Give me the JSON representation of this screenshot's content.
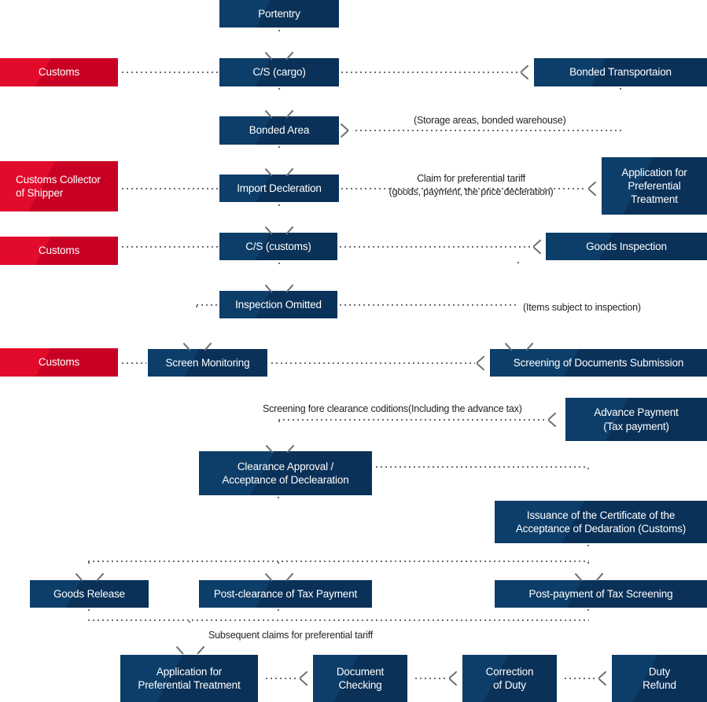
{
  "diagram": {
    "title": "Import Customs Clearance Procedure Flowchart",
    "colors": {
      "navy": "#0b3a63",
      "red": "#d90429",
      "connector": "#6d6e71",
      "label_text": "#231f20",
      "background": "#ffffff"
    }
  },
  "actors": [
    {
      "id": "actor-customs-1",
      "label": "Customs"
    },
    {
      "id": "actor-customs-collector",
      "label": "Customs Collector\nof Shipper",
      "line1": "Customs Collector",
      "line2": "of Shipper"
    },
    {
      "id": "actor-customs-2",
      "label": "Customs"
    },
    {
      "id": "actor-customs-3",
      "label": "Customs"
    }
  ],
  "nodes": {
    "portentry": "Portentry",
    "cs_cargo": "C/S (cargo)",
    "bonded_transportation": "Bonded Transportaion",
    "bonded_area": "Bonded Area",
    "import_declaration": "Import Decleration",
    "application_preferential_1_line1": "Application for",
    "application_preferential_1_line2": "Preferential",
    "application_preferential_1_line3": "Treatment",
    "cs_customs": "C/S (customs)",
    "goods_inspection": "Goods Inspection",
    "inspection_omitted": "Inspection Omitted",
    "screen_monitoring": "Screen Monitoring",
    "screening_docs": "Screening of Documents Submission",
    "advance_payment_line1": "Advance Payment",
    "advance_payment_line2": "(Tax payment)",
    "clearance_approval_line1": "Clearance Approval /",
    "clearance_approval_line2": "Acceptance of Declearation",
    "issuance_line1": "Issuance of the Certificate of the",
    "issuance_line2": "Acceptance of Dedaration (Customs)",
    "goods_release": "Goods Release",
    "post_clearance": "Post-clearance of Tax Payment",
    "post_payment": "Post-payment of Tax Screening",
    "application_preferential_2_line1": "Application for",
    "application_preferential_2_line2": "Preferential Treatment",
    "document_checking_line1": "Document",
    "document_checking_line2": "Checking",
    "correction_duty_line1": "Correction",
    "correction_duty_line2": "of Duty",
    "duty_refund_line1": "Duty",
    "duty_refund_line2": "Refund"
  },
  "edge_labels": {
    "storage_areas": "(Storage areas, bonded warehouse)",
    "claim_tariff_line1": "Claim for preferential tariff",
    "claim_tariff_line2": "(goods, payment, the price decleration)",
    "items_subject": "(Items subject to inspection)",
    "screening_fore": "Screening fore clearance coditions(Including the advance tax)",
    "subsequent_claims": "Subsequent claims for preferential tariff"
  }
}
